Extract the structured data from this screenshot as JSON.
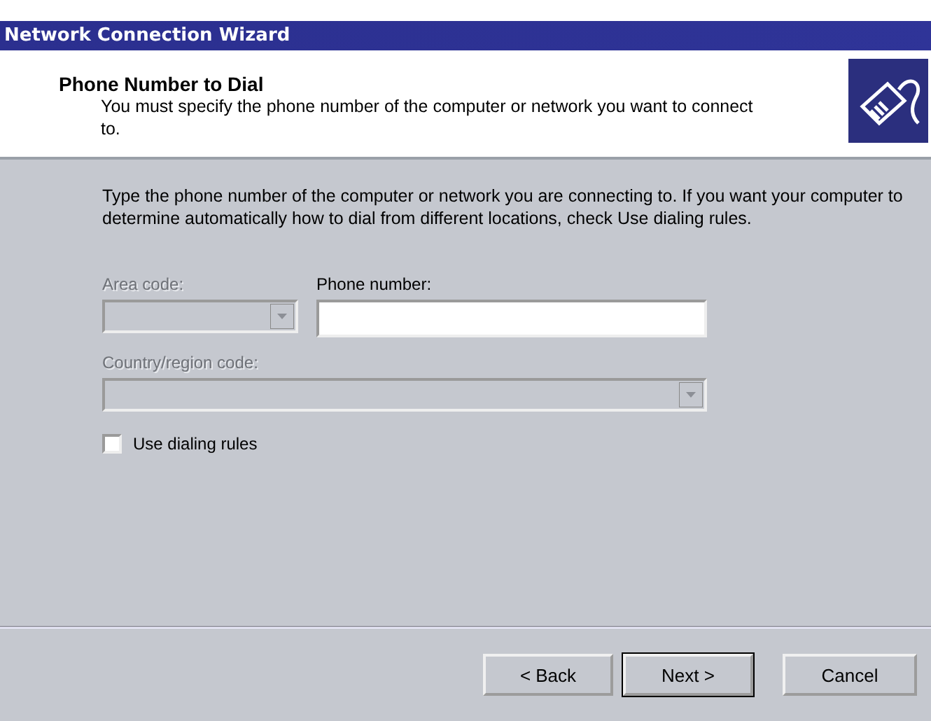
{
  "window": {
    "title": "Network Connection Wizard"
  },
  "header": {
    "title": "Phone Number to Dial",
    "subtitle": "You must specify the phone number of the computer or network you want to connect to."
  },
  "instructions": "Type the phone number of the computer or network you are connecting to. If you want your computer to determine automatically how to dial from different locations, check Use dialing rules.",
  "area_code": {
    "label": "Area code:",
    "disabled": true
  },
  "phone_number": {
    "label": "Phone number:",
    "disabled": false
  },
  "country_code": {
    "label": "Country/region code:",
    "disabled": true
  },
  "dialing_rules": {
    "label": "Use dialing rules",
    "checked": false
  },
  "buttons": [
    {
      "label": "< Back",
      "default": false
    },
    {
      "label": "Next >",
      "default": true
    },
    {
      "label": "Cancel",
      "default": false
    }
  ]
}
